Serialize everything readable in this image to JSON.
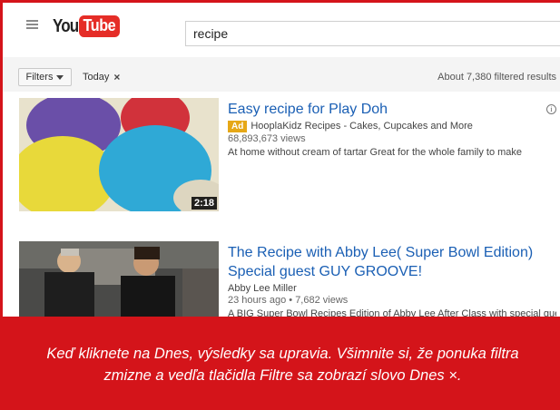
{
  "app": {
    "logo_you": "You",
    "logo_tube": "Tube"
  },
  "search": {
    "query": "recipe"
  },
  "filters": {
    "button_label": "Filters",
    "chip_label": "Today",
    "chip_close": "×",
    "results_count": "About 7,380 filtered results"
  },
  "results": [
    {
      "title": "Easy recipe for Play Doh",
      "ad_label": "Ad",
      "channel": "HooplaKidz Recipes - Cakes, Cupcakes and More",
      "views": "68,893,673 views",
      "description": "At home without cream of tartar Great for the whole family to make",
      "duration": "2:18",
      "info_icon": "info-icon"
    },
    {
      "title_line1": "The Recipe with Abby Lee( Super Bowl Edition)",
      "title_line2": "Special guest GUY GROOVE!",
      "channel": "Abby Lee Miller",
      "age": "23 hours ago",
      "views": "7,682 views",
      "description": "A BIG Super Bowl Recipes Edition of Abby Lee After Class with special guest"
    }
  ],
  "caption": {
    "line1": "Keď kliknete na Dnes, výsledky sa upravia. Všimnite si, že ponuka filtra",
    "line2": "zmizne a vedľa tlačidla Filtre sa zobrazí slovo Dnes ×."
  },
  "colors": {
    "accent_red": "#d4141a",
    "link_blue": "#1a5fb4",
    "ad_yellow": "#e6a817"
  }
}
